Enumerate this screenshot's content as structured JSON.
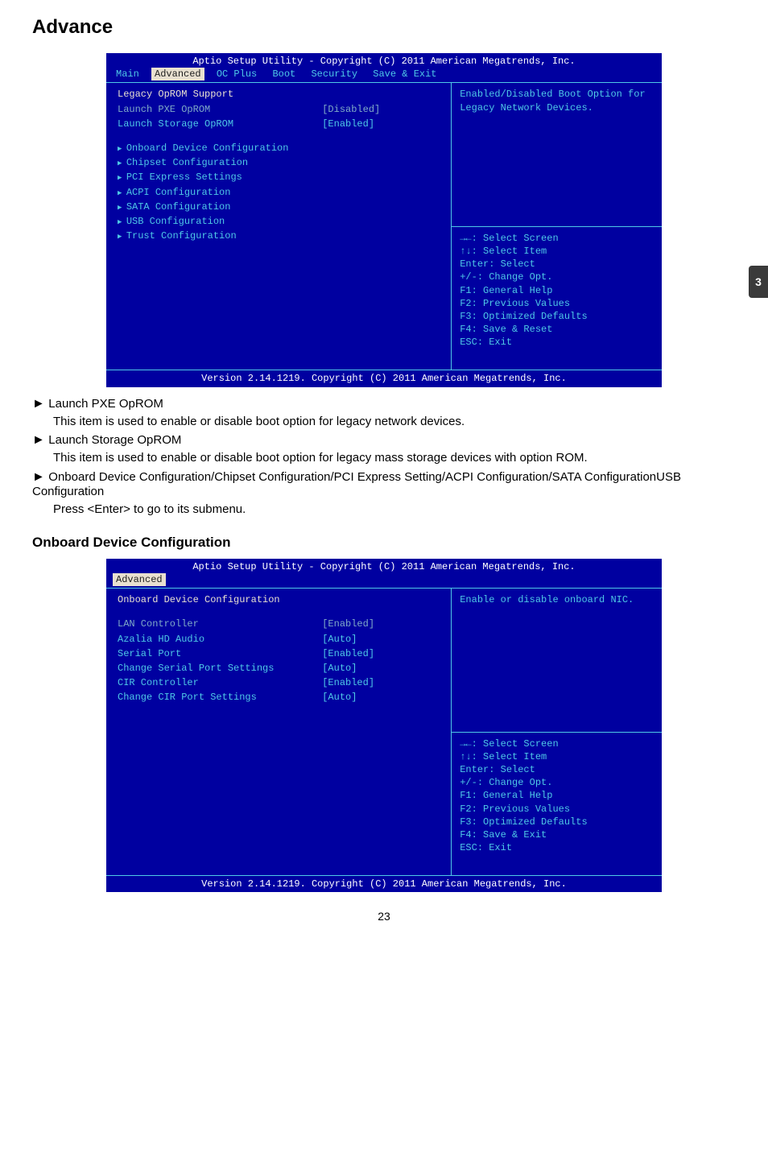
{
  "page": {
    "title": "Advance",
    "number": "23",
    "side_tab": "3"
  },
  "bios1": {
    "top": "Aptio Setup Utility - Copyright (C) 2011 American Megatrends, Inc.",
    "tabs": [
      "Main",
      "Advanced",
      "OC Plus",
      "Boot",
      "Security",
      "Save & Exit"
    ],
    "active_tab": "Advanced",
    "heading_white": "Legacy OpROM Support",
    "opt_pxe_label": "Launch PXE OpROM",
    "opt_pxe_value": "[Disabled]",
    "opt_storage_label": "Launch Storage OpROM",
    "opt_storage_value": "[Enabled]",
    "subs": [
      "Onboard Device Configuration",
      "Chipset Configuration",
      "PCI Express Settings",
      "ACPI Configuration",
      "SATA Configuration",
      "USB Configuration",
      "Trust Configuration"
    ],
    "help": "Enabled/Disabled Boot Option for Legacy Network Devices.",
    "keys": "→←: Select Screen\n↑↓: Select Item\nEnter: Select\n+/-: Change Opt.\nF1: General Help\nF2: Previous Values\nF3: Optimized Defaults\nF4: Save & Reset\nESC: Exit",
    "bottom": "Version 2.14.1219. Copyright (C) 2011 American Megatrends, Inc."
  },
  "doc_items": [
    {
      "heading": "Launch PXE OpROM",
      "body": "This item is used to enable or disable boot option for legacy network devices."
    },
    {
      "heading": "Launch Storage OpROM",
      "body": "This item is used to enable or disable boot option for legacy mass storage devices with option ROM."
    },
    {
      "heading": "Onboard Device Configuration/Chipset Configuration/PCI Express Setting/ACPI Configuration/SATA ConfigurationUSB Configuration",
      "body": "Press <Enter> to go to its submenu."
    }
  ],
  "subsection_title": "Onboard Device Configuration",
  "bios2": {
    "top": "Aptio Setup Utility - Copyright (C) 2011 American Megatrends, Inc.",
    "tabs_single": "Advanced",
    "heading_white": "Onboard Device Configuration",
    "rows": [
      {
        "label": "LAN Controller",
        "value": "[Enabled]",
        "muted": true
      },
      {
        "label": "Azalia HD Audio",
        "value": "[Auto]",
        "muted": false
      },
      {
        "label": "Serial Port",
        "value": "[Enabled]",
        "muted": false
      },
      {
        "label": " Change Serial Port Settings",
        "value": "[Auto]",
        "muted": false
      },
      {
        "label": "CIR Controller",
        "value": "[Enabled]",
        "muted": false
      },
      {
        "label": " Change CIR Port Settings",
        "value": "[Auto]",
        "muted": false
      }
    ],
    "help": "Enable or disable onboard NIC.",
    "keys": "→←: Select Screen\n↑↓: Select Item\nEnter: Select\n+/-: Change Opt.\nF1: General Help\nF2: Previous Values\nF3: Optimized Defaults\nF4: Save & Exit\nESC: Exit",
    "bottom": "Version 2.14.1219. Copyright (C) 2011 American Megatrends, Inc."
  }
}
